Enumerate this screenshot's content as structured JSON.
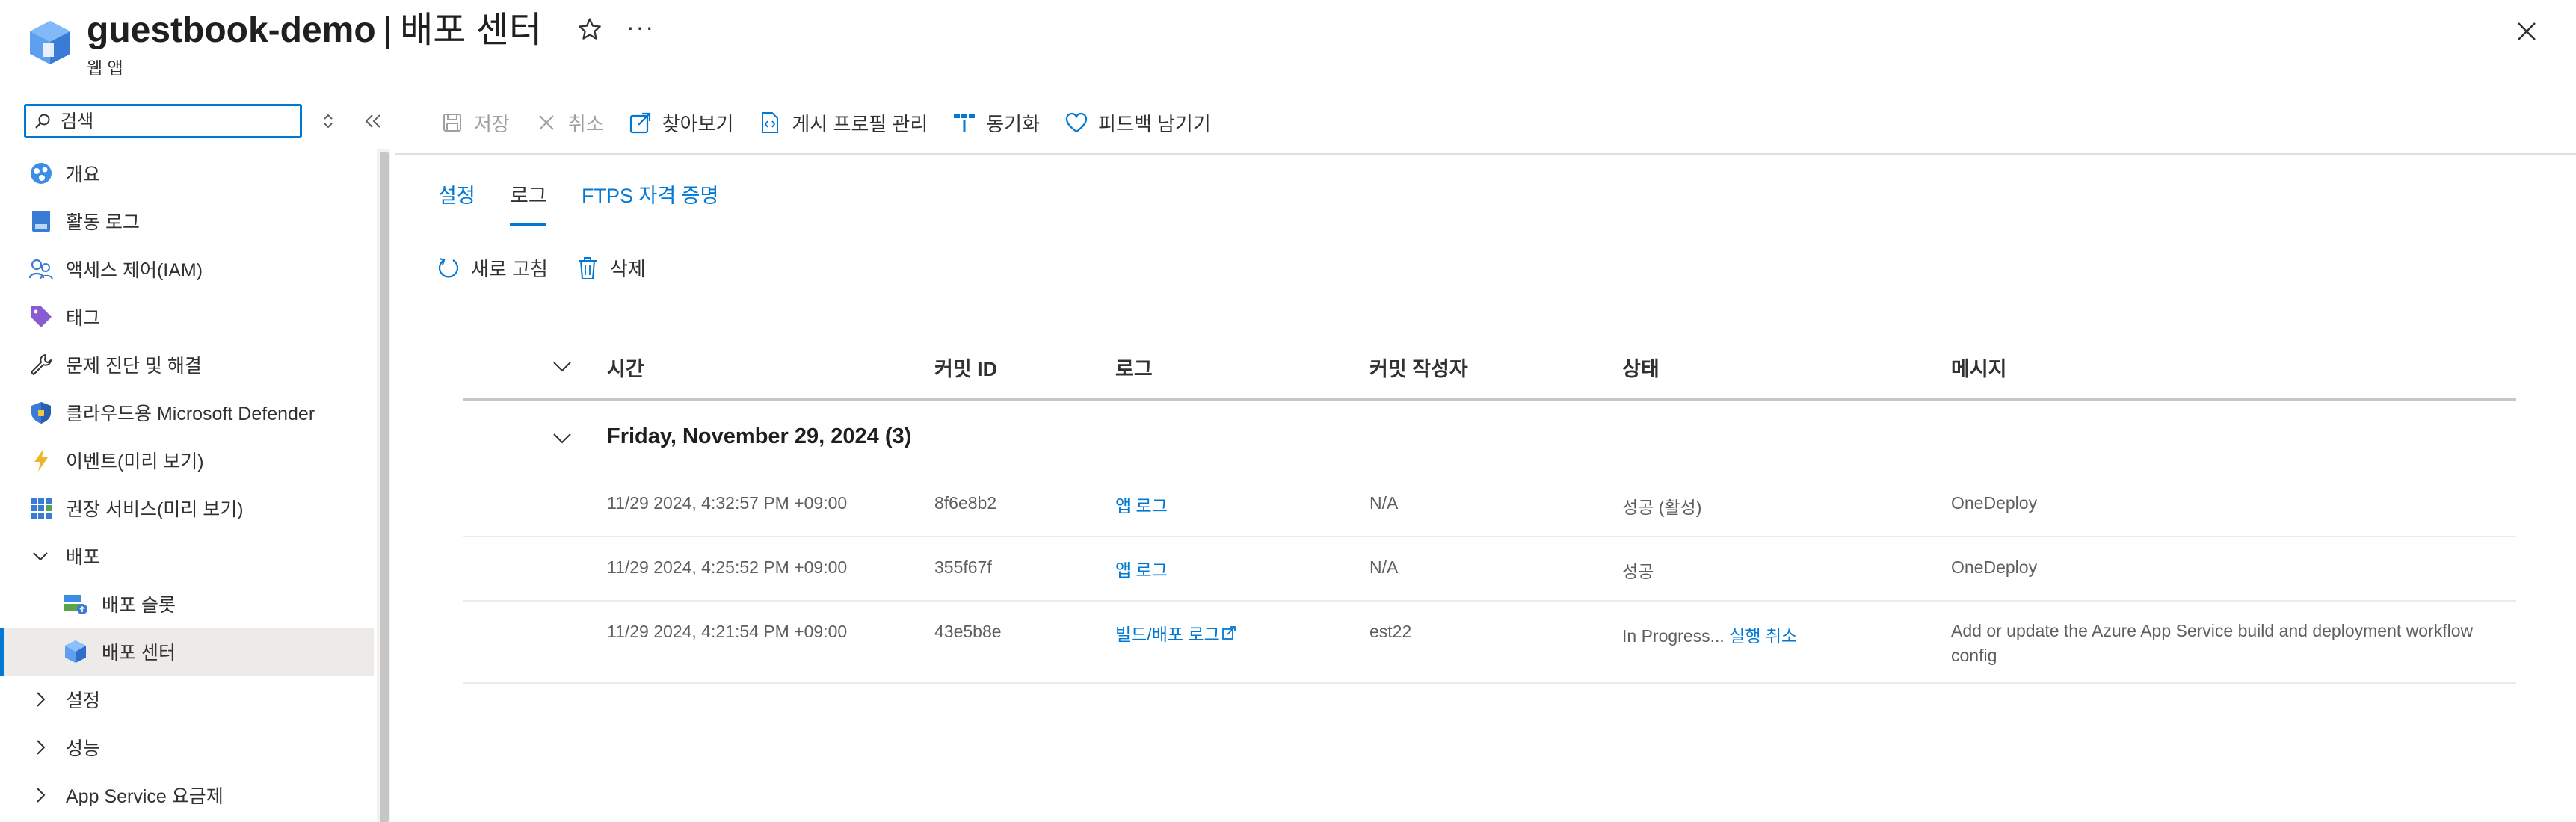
{
  "header": {
    "resource_name": "guestbook-demo",
    "separator": "|",
    "page_name": "배포 센터",
    "subtitle": "웹 앱",
    "more": "···"
  },
  "sidebar": {
    "search_placeholder": "검색",
    "items": [
      {
        "label": "개요",
        "icon": "overview-icon"
      },
      {
        "label": "활동 로그",
        "icon": "activity-log-icon"
      },
      {
        "label": "액세스 제어(IAM)",
        "icon": "people-icon"
      },
      {
        "label": "태그",
        "icon": "tag-icon"
      },
      {
        "label": "문제 진단 및 해결",
        "icon": "wrench-icon"
      },
      {
        "label": "클라우드용 Microsoft Defender",
        "icon": "shield-icon"
      },
      {
        "label": "이벤트(미리 보기)",
        "icon": "lightning-icon"
      },
      {
        "label": "권장 서비스(미리 보기)",
        "icon": "grid-icon"
      },
      {
        "label": "배포",
        "icon": "chevron-down-icon"
      },
      {
        "label": "배포 슬롯",
        "icon": "slots-icon"
      },
      {
        "label": "배포 센터",
        "icon": "cube-icon"
      },
      {
        "label": "설정",
        "icon": "chevron-right-icon"
      },
      {
        "label": "성능",
        "icon": "chevron-right-icon"
      },
      {
        "label": "App Service 요금제",
        "icon": "chevron-right-icon"
      }
    ]
  },
  "toolbar": {
    "save": "저장",
    "cancel": "취소",
    "browse": "찾아보기",
    "manage_publish_profile": "게시 프로필 관리",
    "sync": "동기화",
    "feedback": "피드백 남기기"
  },
  "tabs": [
    "설정",
    "로그",
    "FTPS 자격 증명"
  ],
  "actions": {
    "refresh": "새로 고침",
    "delete": "삭제"
  },
  "table": {
    "headers": [
      "시간",
      "커밋 ID",
      "로그",
      "커밋 작성자",
      "상태",
      "메시지"
    ],
    "group_title": "Friday, November 29, 2024 (3)",
    "rows": [
      {
        "time": "11/29 2024, 4:32:57 PM +09:00",
        "commit": "8f6e8b2",
        "log": "앱 로그",
        "author": "N/A",
        "status": "성공 (활성)",
        "status_link": "",
        "message": "OneDeploy"
      },
      {
        "time": "11/29 2024, 4:25:52 PM +09:00",
        "commit": "355f67f",
        "log": "앱 로그",
        "author": "N/A",
        "status": "성공",
        "status_link": "",
        "message": "OneDeploy"
      },
      {
        "time": "11/29 2024, 4:21:54 PM +09:00",
        "commit": "43e5b8e",
        "log": "빌드/배포 로그",
        "author": "est22",
        "status": "In Progress...",
        "status_link": "실행 취소",
        "message": "Add or update the Azure App Service build and deployment workflow config"
      }
    ]
  },
  "colors": {
    "accent": "#0078d4",
    "selected_bg": "#edebe9",
    "text": "#323130"
  }
}
